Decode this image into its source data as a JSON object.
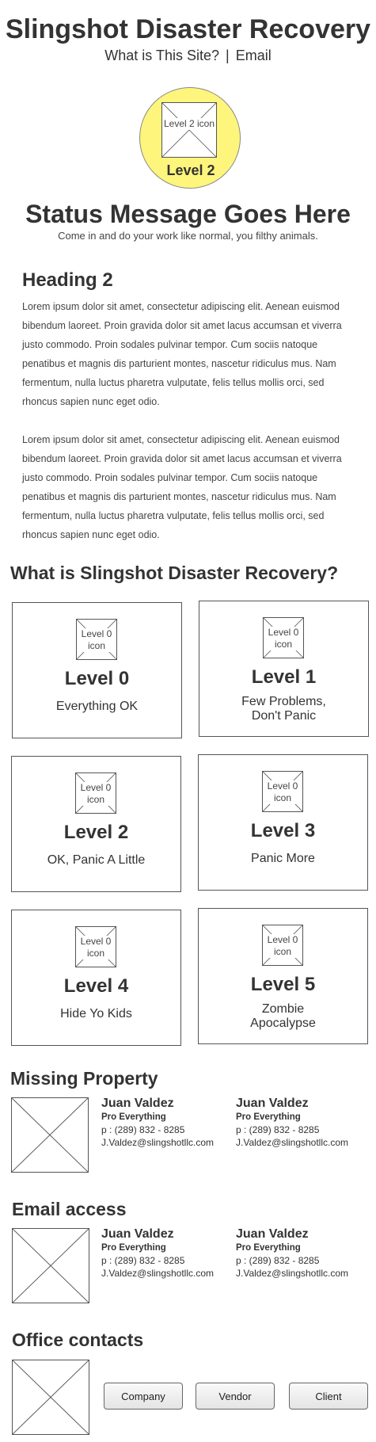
{
  "header": {
    "title": "Slingshot Disaster Recovery",
    "nav": {
      "about_link": "What is This Site?",
      "separator": "|",
      "email_link": "Email"
    }
  },
  "current_level": {
    "icon_label": "Level 2 icon",
    "icon": "level-2-icon",
    "label": "Level 2",
    "color": "#fdf57c"
  },
  "status": {
    "title": "Status Message Goes Here",
    "subtitle": "Come in and do your work like normal, you filthy animals."
  },
  "content": {
    "heading": "Heading 2",
    "paragraphs": [
      "Lorem ipsum dolor sit amet, consectetur adipiscing elit. Aenean euismod bibendum laoreet. Proin gravida dolor sit amet lacus accumsan et viverra justo commodo. Proin sodales pulvinar tempor. Cum sociis natoque penatibus et magnis dis parturient montes, nascetur ridiculus mus. Nam fermentum, nulla luctus pharetra vulputate, felis tellus mollis orci, sed rhoncus sapien nunc eget odio.",
      "Lorem ipsum dolor sit amet, consectetur adipiscing elit. Aenean euismod bibendum laoreet. Proin gravida dolor sit amet lacus accumsan et viverra justo commodo. Proin sodales pulvinar tempor. Cum sociis natoque penatibus et magnis dis parturient montes, nascetur ridiculus mus. Nam fermentum, nulla luctus pharetra vulputate, felis tellus mollis orci, sed rhoncus sapien nunc eget odio."
    ]
  },
  "levels_section": {
    "title": "What is Slingshot Disaster Recovery?",
    "levels": [
      {
        "icon_label": "Level 0 icon",
        "title": "Level 0",
        "description": "Everything OK"
      },
      {
        "icon_label": "Level 0 icon",
        "title": "Level 1",
        "description": "Few Problems, Don't Panic"
      },
      {
        "icon_label": "Level 0 icon",
        "title": "Level 2",
        "description": "OK, Panic A Little"
      },
      {
        "icon_label": "Level 0 icon",
        "title": "Level 3",
        "description": "Panic More"
      },
      {
        "icon_label": "Level 0 icon",
        "title": "Level 4",
        "description": "Hide Yo Kids"
      },
      {
        "icon_label": "Level 0 icon",
        "title": "Level 5",
        "description": "Zombie Apocalypse"
      }
    ]
  },
  "missing_property": {
    "title": "Missing Property",
    "contacts": [
      {
        "name": "Juan Valdez",
        "role": "Pro Everything",
        "phone": "p : (289) 832 - 8285",
        "email": "J.Valdez@slingshotllc.com"
      },
      {
        "name": "Juan Valdez",
        "role": "Pro Everything",
        "phone": "p : (289) 832 - 8285",
        "email": "J.Valdez@slingshotllc.com"
      }
    ]
  },
  "email_access": {
    "title": "Email access",
    "contacts": [
      {
        "name": "Juan Valdez",
        "role": "Pro Everything",
        "phone": "p : (289) 832 - 8285",
        "email": "J.Valdez@slingshotllc.com"
      },
      {
        "name": "Juan Valdez",
        "role": "Pro Everything",
        "phone": "p : (289) 832 - 8285",
        "email": "J.Valdez@slingshotllc.com"
      }
    ]
  },
  "office_contacts": {
    "title": "Office contacts",
    "buttons": [
      "Company",
      "Vendor",
      "Client"
    ]
  }
}
